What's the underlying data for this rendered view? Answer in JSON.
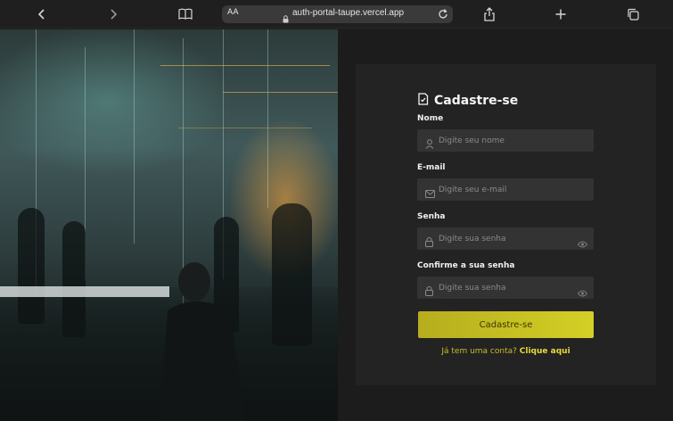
{
  "browser": {
    "text_size_label": "AA",
    "url": "auth-portal-taupe.vercel.app"
  },
  "form": {
    "title": "Cadastre-se",
    "fields": [
      {
        "label": "Nome",
        "placeholder": "Digite seu nome",
        "icon": "user-icon"
      },
      {
        "label": "E-mail",
        "placeholder": "Digite seu e-mail",
        "icon": "mail-icon"
      },
      {
        "label": "Senha",
        "placeholder": "Digite sua senha",
        "icon": "lock-icon"
      },
      {
        "label": "Confirme a sua senha",
        "placeholder": "Digite sua senha",
        "icon": "lock-icon"
      }
    ],
    "submit_label": "Cadastre-se",
    "login_question": "Já tem uma conta?",
    "login_link": "Clique aqui"
  },
  "colors": {
    "accent": "#d4d026",
    "panel": "#232323",
    "input": "#333333"
  }
}
